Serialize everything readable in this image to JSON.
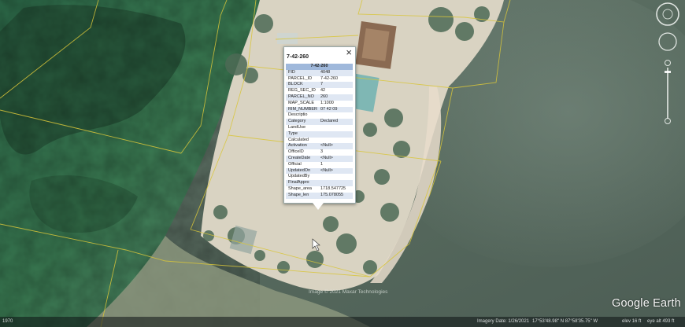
{
  "colors": {
    "land": "#2f6650",
    "forest": "#356d41",
    "sand": "#dcd6c6",
    "sea": "#556b5e",
    "parcel_line": "#d9c63a",
    "header_row": "#9fb8db",
    "alt_row": "#dfe7f3"
  },
  "icons": {
    "close": "close-icon",
    "cursor": "cursor-arrow-icon",
    "look": "look-around-joystick-icon",
    "move": "move-joystick-icon",
    "zoom": "zoom-slider-icon"
  },
  "popup": {
    "title": "7-42-260",
    "close_label": "×",
    "header": "7-42-260",
    "rows": [
      {
        "key": "FID",
        "value": "4048"
      },
      {
        "key": "PARCEL_ID",
        "value": "7-42-260"
      },
      {
        "key": "BLOCK",
        "value": "7"
      },
      {
        "key": "REG_SEC_ID",
        "value": "42"
      },
      {
        "key": "PARCEL_NO",
        "value": "260"
      },
      {
        "key": "MAP_SCALE",
        "value": "1:1000"
      },
      {
        "key": "RIM_NUMBER",
        "value": "07 42 09"
      },
      {
        "key": "Descriptio",
        "value": ""
      },
      {
        "key": "Category",
        "value": "Declared"
      },
      {
        "key": "LandUse",
        "value": ""
      },
      {
        "key": "Type",
        "value": ""
      },
      {
        "key": "Calculated",
        "value": ""
      },
      {
        "key": "Activation",
        "value": "<Null>"
      },
      {
        "key": "OfficeID",
        "value": "3"
      },
      {
        "key": "CreateDate",
        "value": "<Null>"
      },
      {
        "key": "Official",
        "value": "1"
      },
      {
        "key": "UpdatedOn",
        "value": "<Null>"
      },
      {
        "key": "UpdatedBy",
        "value": ""
      },
      {
        "key": "FinalAppro",
        "value": ""
      },
      {
        "key": "Shape_area",
        "value": "1718.547725"
      },
      {
        "key": "Shape_len",
        "value": "175.078055"
      }
    ]
  },
  "status_bar": {
    "year": "1970",
    "imagery_date": "Imagery Date: 1/26/2021",
    "coordinates": "17°53'48.98\" N   87°58'35.75\" W",
    "elevation": "elev  16 ft",
    "eye_alt": "eye alt  493 ft"
  },
  "copyright": "Image © 2021 Maxar Technologies",
  "brand": "Google Earth"
}
